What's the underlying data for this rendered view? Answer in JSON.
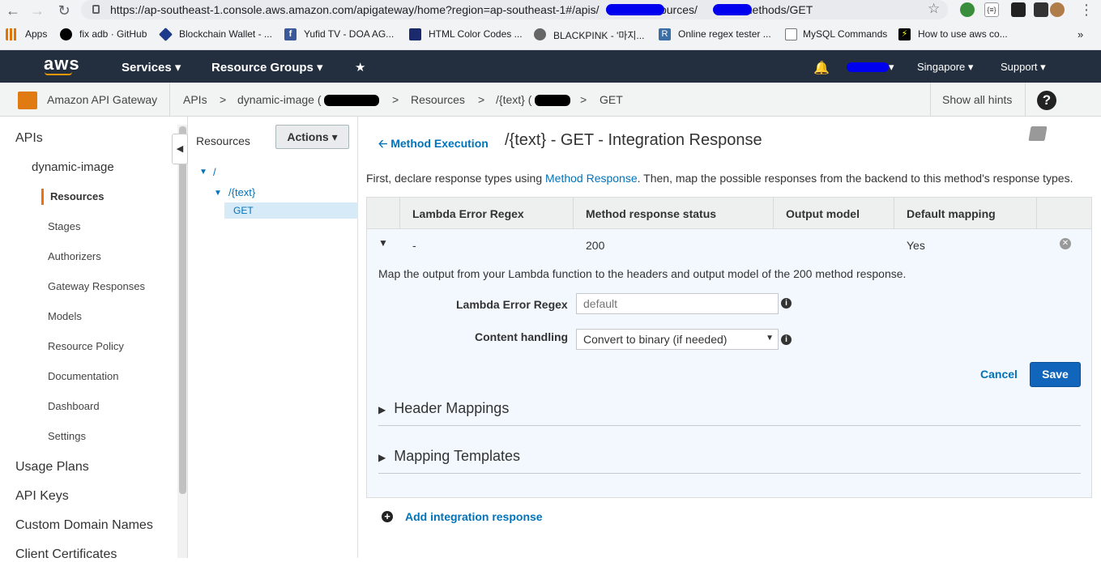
{
  "browser": {
    "url": "https://ap-southeast-1.console.aws.amazon.com/apigateway/home?region=ap-southeast-1#/apis/",
    "url_part2": "resources/",
    "url_part3": "methods/GET",
    "bookmarks": [
      {
        "label": "Apps",
        "icon": "apps-grid-icon",
        "color": "#e37400"
      },
      {
        "label": "fix adb · GitHub",
        "icon": "github-icon",
        "color": "#000000"
      },
      {
        "label": "Blockchain Wallet - ...",
        "icon": "blockchain-icon",
        "color": "#1e3a8a"
      },
      {
        "label": "Yufid TV - DOA AG...",
        "icon": "facebook-icon",
        "color": "#3b5998"
      },
      {
        "label": "HTML Color Codes ...",
        "icon": "html-color-icon",
        "color": "#1a2a6c"
      },
      {
        "label": "BLACKPINK - '마지...",
        "icon": "blackpink-icon",
        "color": "#555555"
      },
      {
        "label": "Online regex tester ...",
        "icon": "regex-icon",
        "color": "#3a6ea5"
      },
      {
        "label": "MySQL Commands",
        "icon": "page-icon",
        "color": "#777777"
      },
      {
        "label": "How to use aws co...",
        "icon": "lightning-icon",
        "color": "#000000"
      }
    ],
    "more_bookmarks": "»"
  },
  "awsnav": {
    "logo": "aws",
    "services": "Services",
    "resource_groups": "Resource Groups",
    "region": "Singapore",
    "support": "Support"
  },
  "breadcrumb": {
    "service": "Amazon API Gateway",
    "apis": "APIs",
    "api_name": "dynamic-image (",
    "resources": "Resources",
    "resource": "/{text} (",
    "method": "GET",
    "sep": ">",
    "hints": "Show all hints",
    "help": "?"
  },
  "sidebar": {
    "apis": "APIs",
    "api_name": "dynamic-image",
    "items": [
      "Resources",
      "Stages",
      "Authorizers",
      "Gateway Responses",
      "Models",
      "Resource Policy",
      "Documentation",
      "Dashboard",
      "Settings"
    ],
    "bottom": [
      "Usage Plans",
      "API Keys",
      "Custom Domain Names",
      "Client Certificates"
    ]
  },
  "tree": {
    "title": "Resources",
    "actions": "Actions",
    "root": "/",
    "child": "/{text}",
    "method": "GET"
  },
  "main": {
    "back_link": "Method Execution",
    "title": "/{text} - GET - Integration Response",
    "desc_prefix": "First, declare response types using ",
    "desc_link": "Method Response",
    "desc_suffix": ". Then, map the possible responses from the backend to this method's response types.",
    "columns": [
      "Lambda Error Regex",
      "Method response status",
      "Output model",
      "Default mapping"
    ],
    "row": {
      "regex": "-",
      "status": "200",
      "model": "",
      "default": "Yes"
    },
    "panel_desc": "Map the output from your Lambda function to the headers and output model of the 200 method response.",
    "regex_label": "Lambda Error Regex",
    "regex_placeholder": "default",
    "content_label": "Content handling",
    "content_value": "Convert to binary (if needed)",
    "cancel": "Cancel",
    "save": "Save",
    "header_mappings": "Header Mappings",
    "mapping_templates": "Mapping Templates",
    "add_response": "Add integration response"
  },
  "colors": {
    "aws_nav": "#232f3e",
    "accent_orange": "#ec7211",
    "link_blue": "#0073bb",
    "save_blue": "#1166bb"
  }
}
